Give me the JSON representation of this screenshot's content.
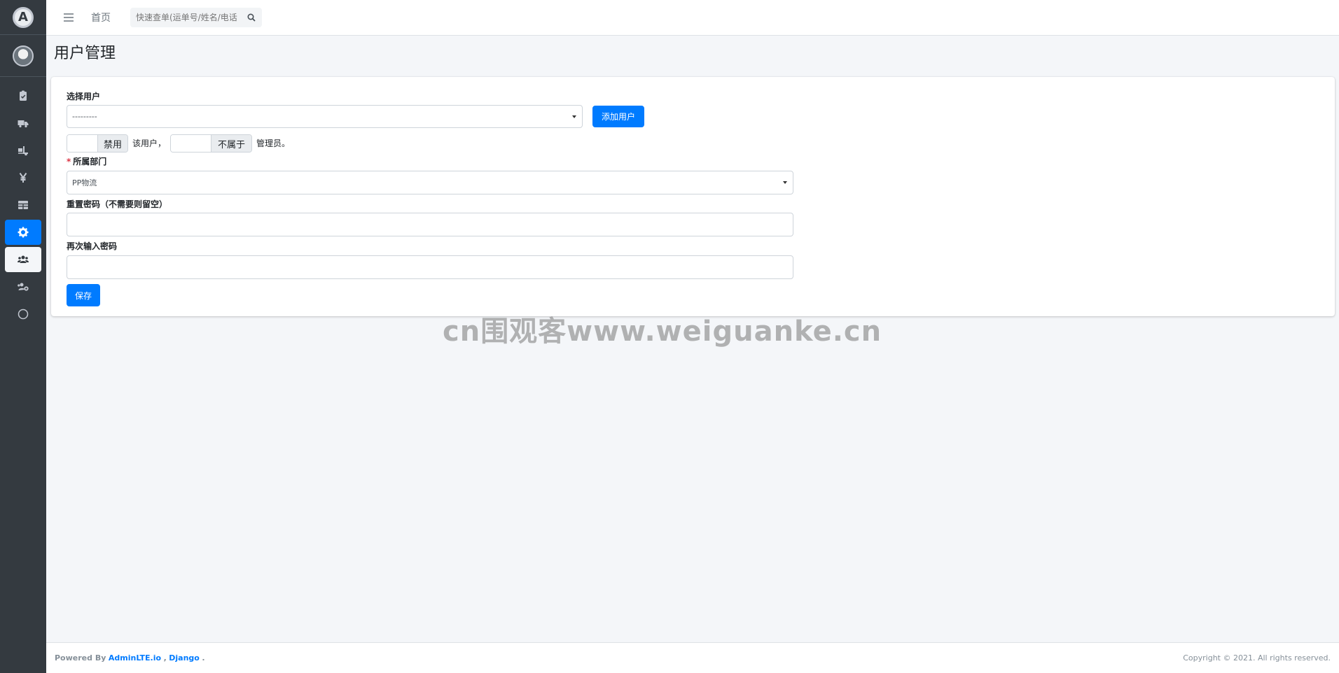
{
  "sidebar": {
    "brand_letter": "A",
    "items": [
      {
        "icon": "clipboard-icon",
        "state": "normal"
      },
      {
        "icon": "truck-icon",
        "state": "normal"
      },
      {
        "icon": "truck-loading-icon",
        "state": "normal"
      },
      {
        "icon": "yen-icon",
        "state": "normal"
      },
      {
        "icon": "table-icon",
        "state": "normal"
      },
      {
        "icon": "gear-icon",
        "state": "active"
      },
      {
        "icon": "users-icon",
        "state": "selected"
      },
      {
        "icon": "users-gear-icon",
        "state": "normal"
      },
      {
        "icon": "circle-icon",
        "state": "normal"
      }
    ],
    "brand_color": "#007bff"
  },
  "navbar": {
    "home": "首页",
    "search_placeholder": "快速查单(运单号/姓名/电话"
  },
  "page": {
    "title": "用户管理"
  },
  "form": {
    "select_user_label": "选择用户",
    "select_user_value": "---------",
    "add_user_button": "添加用户",
    "disable_addon": "禁用",
    "this_user_text": "该用户，",
    "not_belong_addon": "不属于",
    "admin_text": "管理员。",
    "dept_required": "*",
    "dept_label": "所属部门",
    "dept_value": "PP物流",
    "reset_pwd_label": "重置密码（不需要则留空）",
    "confirm_pwd_label": "再次输入密码",
    "save_button": "保存"
  },
  "watermark": "cn围观客www.weiguanke.cn",
  "footer": {
    "powered_by": "Powered By",
    "link1": "AdminLTE.io",
    "sep": ",",
    "link2": "Django",
    "dot": ".",
    "copyright": "Copyright © 2021. All rights reserved."
  }
}
